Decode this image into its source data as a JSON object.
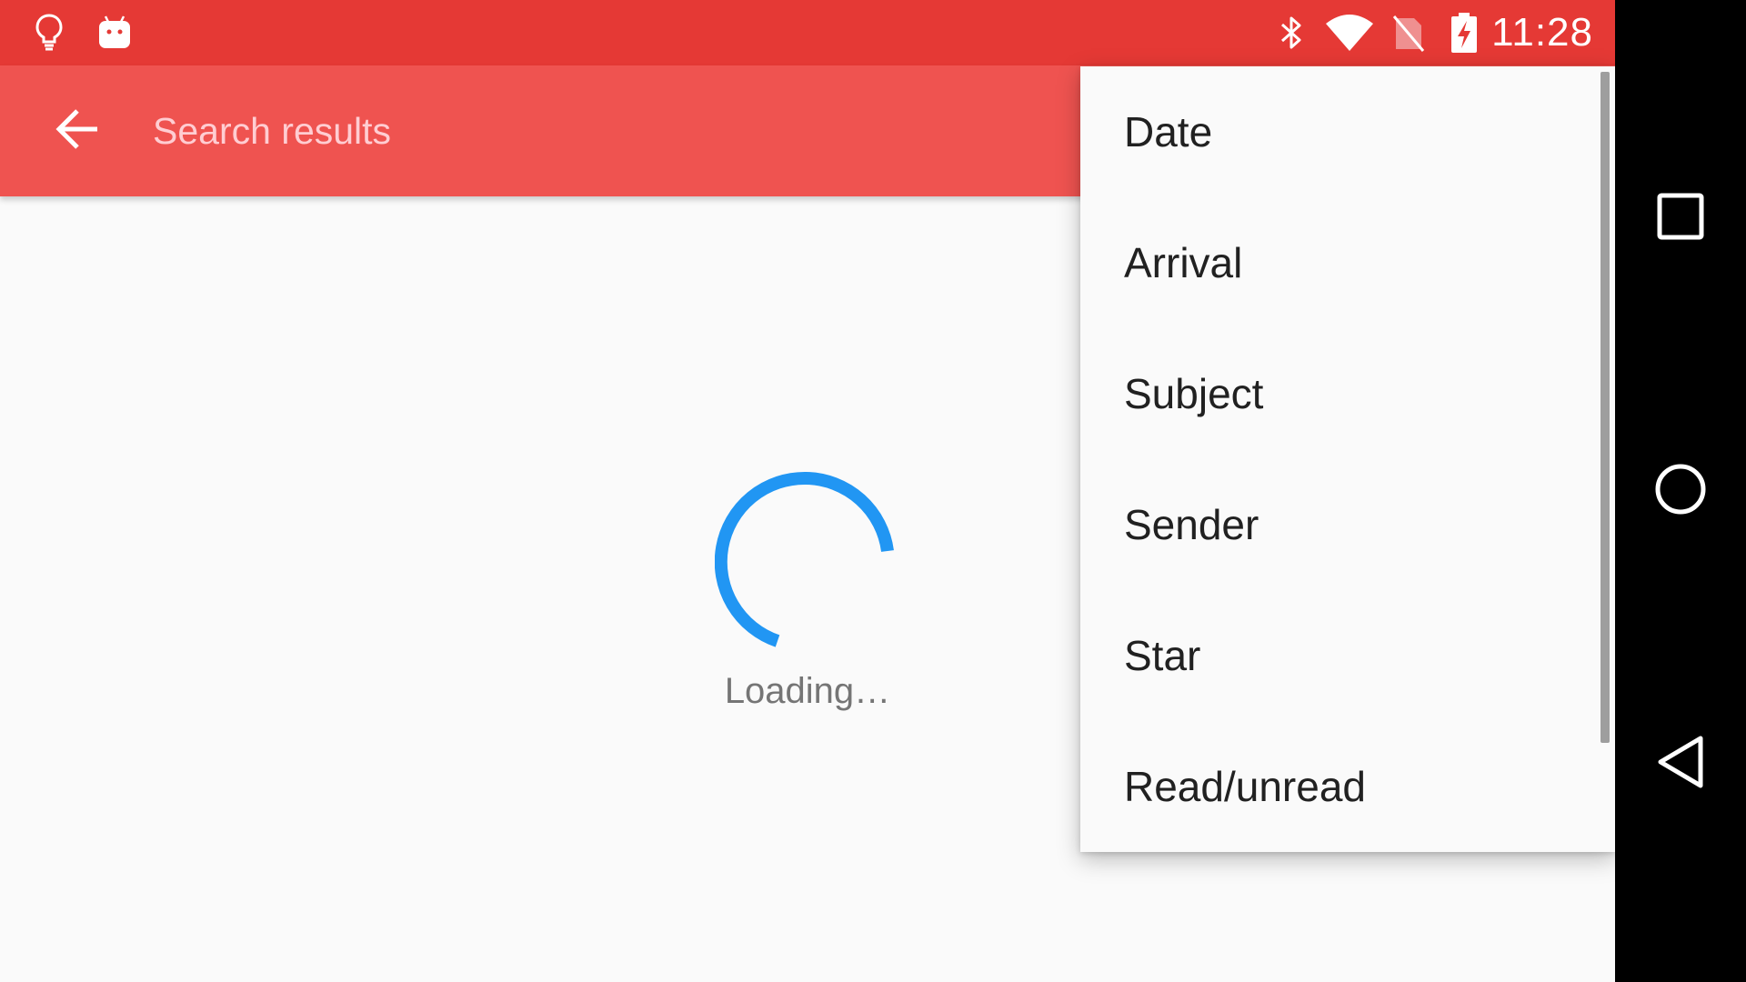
{
  "status_bar": {
    "time": "11:28",
    "icons_left": [
      "lightbulb-icon",
      "android-icon"
    ],
    "icons_right": [
      "bluetooth-icon",
      "wifi-icon",
      "no-sim-icon",
      "battery-charging-icon"
    ],
    "color": "#e53935"
  },
  "toolbar": {
    "title": "Search results",
    "back_icon": "arrow-back-icon",
    "color": "#ef5350"
  },
  "main": {
    "loading_text": "Loading…",
    "spinner_color": "#2196f3"
  },
  "sort_menu": {
    "items": [
      {
        "label": "Date"
      },
      {
        "label": "Arrival"
      },
      {
        "label": "Subject"
      },
      {
        "label": "Sender"
      },
      {
        "label": "Star"
      },
      {
        "label": "Read/unread"
      }
    ]
  },
  "nav_bar": {
    "buttons": [
      "recents-square-icon",
      "home-circle-icon",
      "back-triangle-icon"
    ]
  }
}
